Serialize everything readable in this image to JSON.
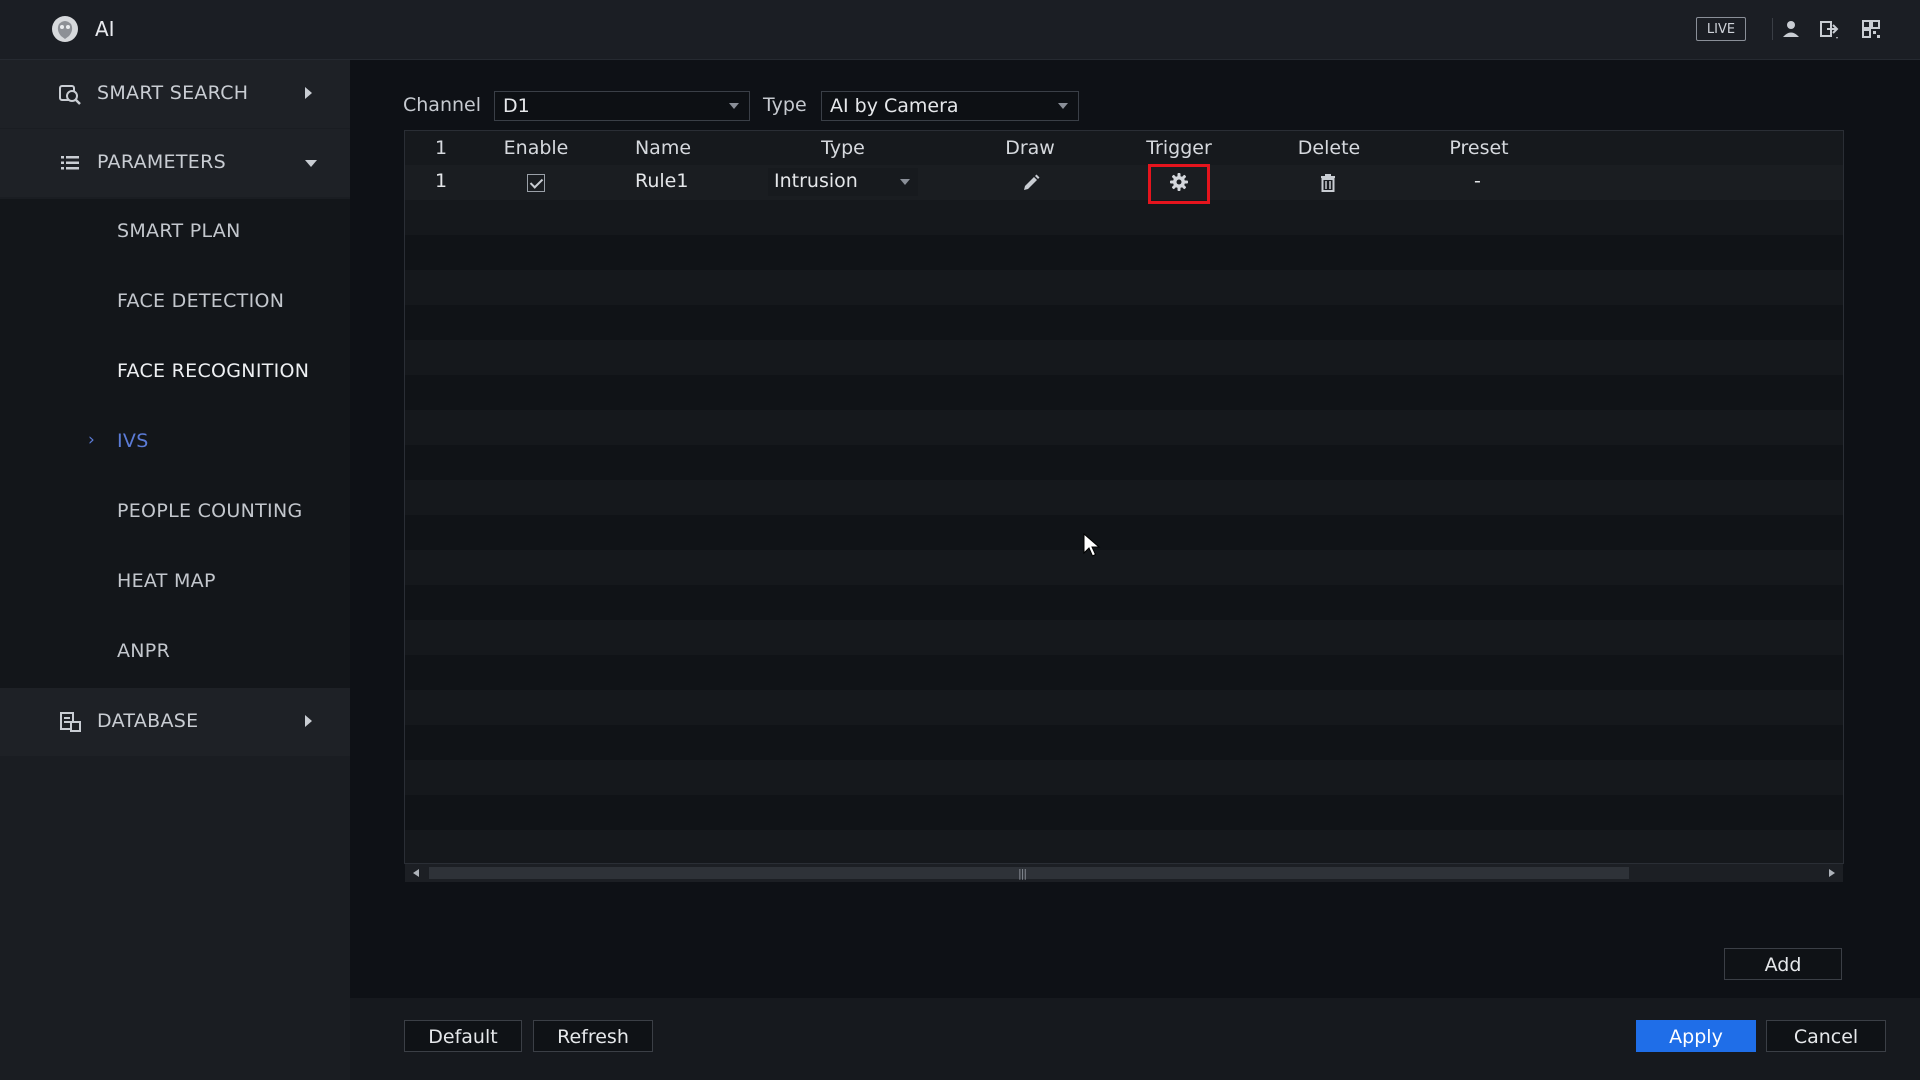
{
  "app": {
    "title": "AI",
    "live_label": "LIVE"
  },
  "sidebar": {
    "groups": [
      {
        "label": "SMART SEARCH",
        "icon": "smart-search-icon"
      },
      {
        "label": "PARAMETERS",
        "icon": "list-icon"
      },
      {
        "label": "DATABASE",
        "icon": "database-icon"
      }
    ],
    "sub_items": [
      {
        "label": "SMART PLAN"
      },
      {
        "label": "FACE DETECTION"
      },
      {
        "label": "FACE RECOGNITION"
      },
      {
        "label": "IVS",
        "active": true
      },
      {
        "label": "PEOPLE COUNTING"
      },
      {
        "label": "HEAT MAP"
      },
      {
        "label": "ANPR"
      }
    ]
  },
  "filters": {
    "channel_label": "Channel",
    "channel_value": "D1",
    "type_label": "Type",
    "type_value": "AI by Camera"
  },
  "table": {
    "headers": [
      "1",
      "Enable",
      "Name",
      "Type",
      "Draw",
      "Trigger",
      "Delete",
      "Preset"
    ],
    "rows": [
      {
        "index": "1",
        "enabled": true,
        "name": "Rule1",
        "type": "Intrusion",
        "preset": "-"
      }
    ]
  },
  "buttons": {
    "add": "Add",
    "default": "Default",
    "refresh": "Refresh",
    "apply": "Apply",
    "cancel": "Cancel"
  },
  "colors": {
    "accent": "#1f6ee8",
    "active_nav": "#5b7bd6",
    "highlight": "#e5141d"
  }
}
